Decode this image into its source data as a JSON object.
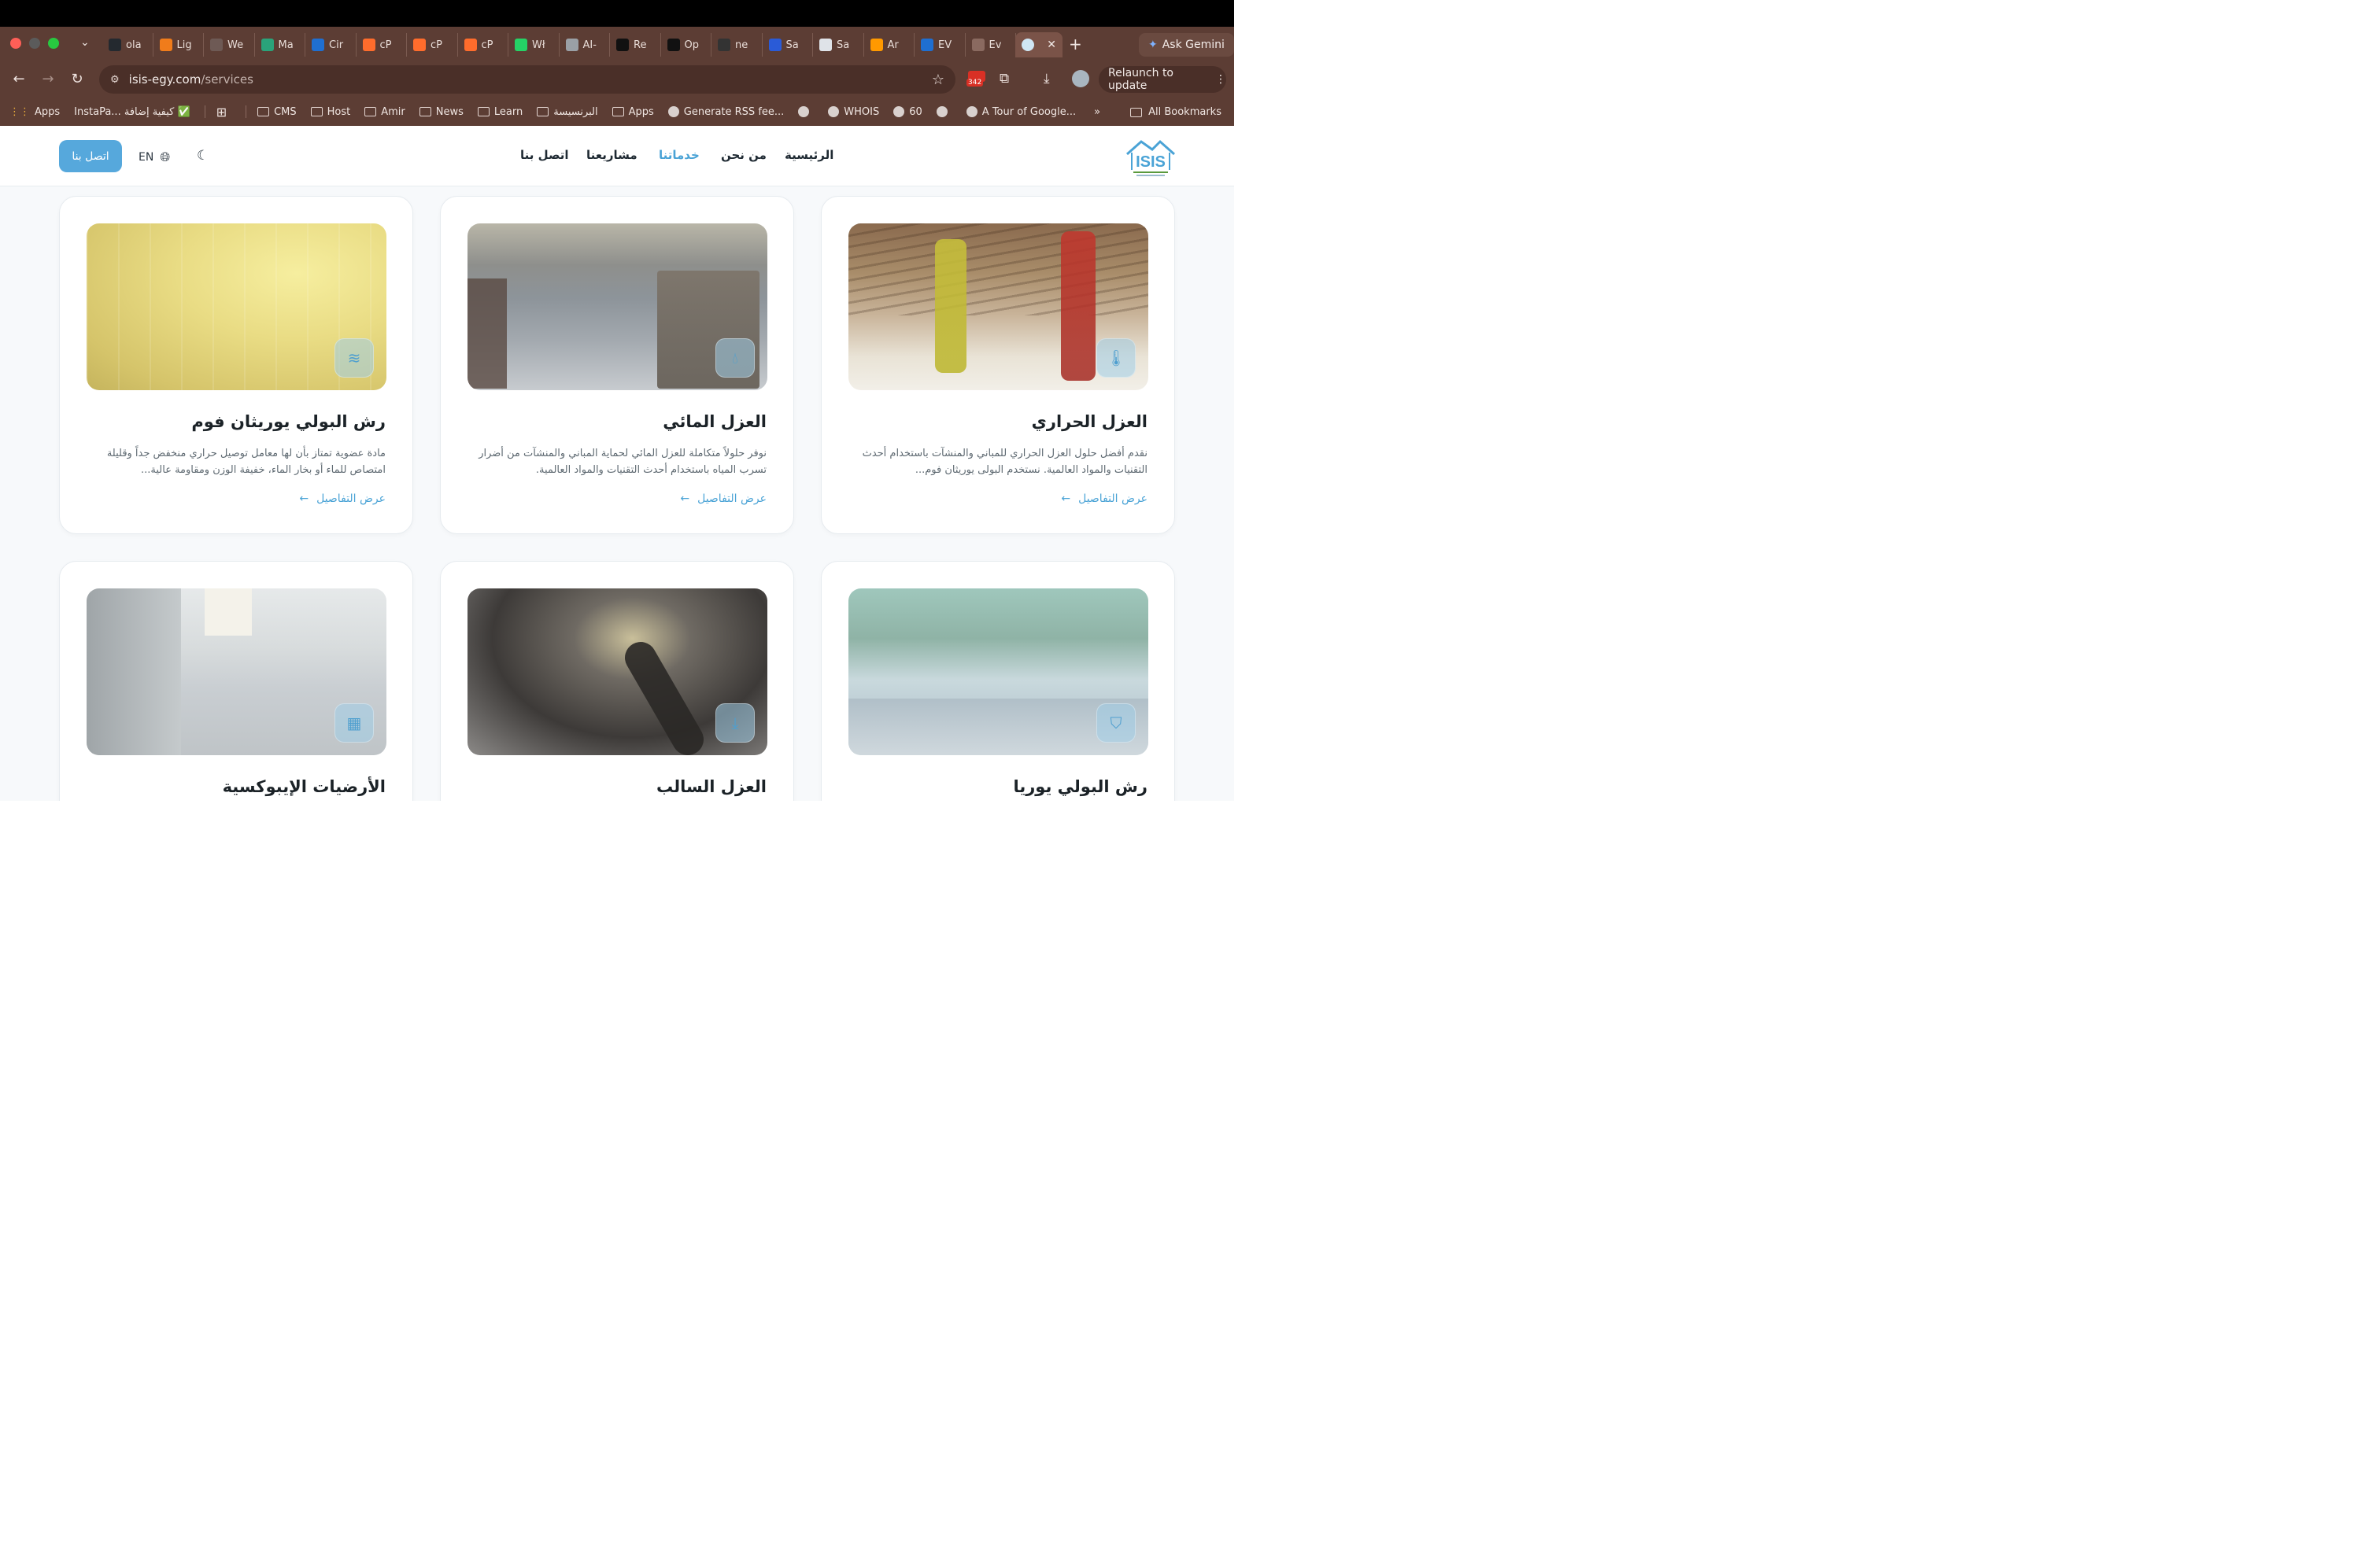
{
  "browser": {
    "tabs": [
      {
        "label": "ola",
        "icon": "github-icon",
        "color": "#24292f"
      },
      {
        "label": "Lig",
        "icon": "lighthouse-icon",
        "color": "#f07c1b"
      },
      {
        "label": "We",
        "icon": "webpage-icon",
        "color": "#6e5a55"
      },
      {
        "label": "Ma",
        "icon": "h-icon",
        "color": "#2aa37a"
      },
      {
        "label": "Cir",
        "icon": "chrome-ext-icon",
        "color": "#1f6fd1"
      },
      {
        "label": "cP",
        "icon": "cpanel-icon",
        "color": "#ff6c2c"
      },
      {
        "label": "cP",
        "icon": "cpanel-icon",
        "color": "#ff6c2c"
      },
      {
        "label": "cP",
        "icon": "cpanel-icon",
        "color": "#ff6c2c"
      },
      {
        "label": "Wł",
        "icon": "whatsapp-icon",
        "color": "#25d366"
      },
      {
        "label": "AI-",
        "icon": "ai-icon",
        "color": "#9aa0a6"
      },
      {
        "label": "Re",
        "icon": "re-icon",
        "color": "#111"
      },
      {
        "label": "Op",
        "icon": "openai-icon",
        "color": "#111"
      },
      {
        "label": "ne",
        "icon": "ne-icon",
        "color": "#333"
      },
      {
        "label": "Sa",
        "icon": "sa-icon",
        "color": "#2a5bd7"
      },
      {
        "label": "Sa",
        "icon": "sa-icon",
        "color": "#dfe3e8"
      },
      {
        "label": "Ar",
        "icon": "amazon-icon",
        "color": "#ff9900"
      },
      {
        "label": "EV",
        "icon": "ev-icon",
        "color": "#1f6fd1"
      },
      {
        "label": "Ev",
        "icon": "ev-icon",
        "color": "#8a6a60"
      }
    ],
    "active_tab_icon": "isis-favicon-icon",
    "new_tab": "+",
    "gemini_label": "Ask Gemini",
    "url_host": "isis-egy.com",
    "url_path": "/services",
    "badge_count": "342",
    "relaunch_label": "Relaunch to update",
    "bookmarks": [
      {
        "label": "Apps",
        "icon": "apps-grid-icon"
      },
      {
        "label": "InstaPa... كيفية إضافة ✅",
        "icon": "none"
      },
      {
        "label": "",
        "icon": "grid-icon"
      },
      {
        "label": "CMS",
        "icon": "folder-icon"
      },
      {
        "label": "Host",
        "icon": "folder-icon"
      },
      {
        "label": "Amir",
        "icon": "folder-icon"
      },
      {
        "label": "News",
        "icon": "folder-icon"
      },
      {
        "label": "Learn",
        "icon": "folder-icon"
      },
      {
        "label": "البرنسيسة",
        "icon": "folder-icon"
      },
      {
        "label": "Apps",
        "icon": "folder-icon"
      },
      {
        "label": "Generate RSS fee...",
        "icon": "rss-icon"
      },
      {
        "label": "",
        "icon": "n-icon"
      },
      {
        "label": "WHOIS",
        "icon": "whois-icon"
      },
      {
        "label": "60",
        "icon": "sixty-icon"
      },
      {
        "label": "",
        "icon": "ext-icon"
      },
      {
        "label": "A Tour of Google...",
        "icon": "google-icon"
      }
    ],
    "overflow": "»",
    "all_bookmarks": "All Bookmarks"
  },
  "site": {
    "logo_text": "ISIS",
    "nav": [
      {
        "label": "الرئيسية",
        "active": false
      },
      {
        "label": "من نحن",
        "active": false
      },
      {
        "label": "خدماتنا",
        "active": true
      },
      {
        "label": "مشاريعنا",
        "active": false
      },
      {
        "label": "اتصل بنا",
        "active": false
      }
    ],
    "contact_button": "اتصل بنا",
    "lang_label": "EN",
    "accent": "#4aa3d6"
  },
  "services": [
    {
      "title": "العزل الحراري",
      "desc": "نقدم أفضل حلول العزل الحراري للمباني والمنشآت باستخدام أحدث التقنيات والمواد العالمية. نستخدم البولى يوريثان فوم...",
      "link": "عرض التفاصيل",
      "icon": "thermometer-icon"
    },
    {
      "title": "العزل المائي",
      "desc": "نوفر حلولاً متكاملة للعزل المائي لحماية المباني والمنشآت من أضرار تسرب المياه باستخدام أحدث التقنيات والمواد العالمية.",
      "link": "عرض التفاصيل",
      "icon": "droplets-icon"
    },
    {
      "title": "رش البولي يوريثان فوم",
      "desc": "مادة عضوية تمتاز بأن لها معامل توصيل حراري منخفض جداً وقليلة امتصاص للماء أو بخار الماء، خفيفة الوزن ومقاومة عالية...",
      "link": "عرض التفاصيل",
      "icon": "layers-icon"
    },
    {
      "title": "رش البولي يوريا",
      "desc": "",
      "link": "",
      "icon": "shield-icon"
    },
    {
      "title": "العزل السالب",
      "desc": "",
      "link": "",
      "icon": "arrow-down-icon"
    },
    {
      "title": "الأرضيات الإيبوكسية",
      "desc": "",
      "link": "",
      "icon": "grid-icon"
    }
  ]
}
